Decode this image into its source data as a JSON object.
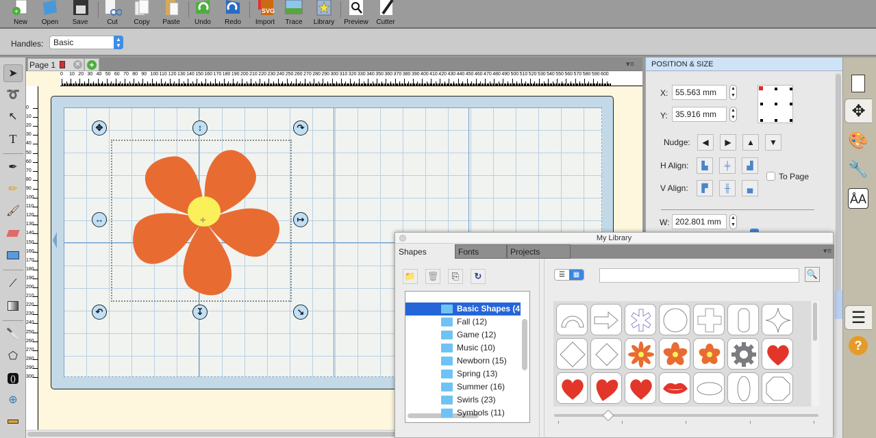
{
  "toolbar": {
    "buttons": [
      {
        "id": "new",
        "label": "New",
        "icon": "new-doc-icon"
      },
      {
        "id": "open",
        "label": "Open",
        "icon": "folder-open-icon"
      },
      {
        "id": "save",
        "label": "Save",
        "icon": "floppy-icon"
      },
      {
        "id": "cut",
        "label": "Cut",
        "icon": "scissors-icon"
      },
      {
        "id": "copy",
        "label": "Copy",
        "icon": "copy-icon"
      },
      {
        "id": "paste",
        "label": "Paste",
        "icon": "paste-icon"
      },
      {
        "id": "undo",
        "label": "Undo",
        "icon": "undo-icon"
      },
      {
        "id": "redo",
        "label": "Redo",
        "icon": "redo-icon"
      },
      {
        "id": "import",
        "label": "Import",
        "icon": "svg-import-icon"
      },
      {
        "id": "trace",
        "label": "Trace",
        "icon": "trace-icon"
      },
      {
        "id": "library",
        "label": "Library",
        "icon": "library-star-icon"
      },
      {
        "id": "preview",
        "label": "Preview",
        "icon": "magnifier-icon"
      },
      {
        "id": "cutter",
        "label": "Cutter",
        "icon": "blade-icon"
      }
    ]
  },
  "handles": {
    "label": "Handles:",
    "value": "Basic"
  },
  "document": {
    "page_tab": "Page 1",
    "hruler_labels": [
      "0",
      "10",
      "20",
      "30",
      "40",
      "50",
      "60",
      "70",
      "80",
      "90",
      "100",
      "110",
      "120",
      "130",
      "140",
      "150",
      "160",
      "170",
      "180",
      "190",
      "200",
      "210",
      "220",
      "230",
      "240",
      "250",
      "260",
      "270",
      "280",
      "290",
      "300",
      "310",
      "320",
      "330",
      "340",
      "350",
      "360",
      "370",
      "380",
      "390",
      "400",
      "410",
      "420",
      "430",
      "440",
      "450",
      "460",
      "470",
      "480",
      "490",
      "500",
      "510",
      "520",
      "530",
      "540",
      "550",
      "560",
      "570",
      "580",
      "590",
      "600"
    ],
    "vruler_labels": [
      "0",
      "10",
      "20",
      "30",
      "40",
      "50",
      "60",
      "70",
      "80",
      "90",
      "100",
      "110",
      "120",
      "130",
      "140",
      "150",
      "160",
      "170",
      "180",
      "190",
      "200",
      "210",
      "220",
      "230",
      "240",
      "250",
      "260",
      "270",
      "280",
      "290",
      "300"
    ]
  },
  "position_size": {
    "header": "POSITION & SIZE",
    "x_label": "X:",
    "x_value": "55.563 mm",
    "y_label": "Y:",
    "y_value": "35.916 mm",
    "nudge_label": "Nudge:",
    "h_align_label": "H Align:",
    "v_align_label": "V Align:",
    "to_page_label": "To Page",
    "to_page_checked": false,
    "w_label": "W:",
    "w_value": "202.801 mm",
    "keep_proportions_checked": true
  },
  "library": {
    "title": "My Library",
    "tabs": [
      "Shapes",
      "Fonts",
      "Projects"
    ],
    "active_tab": "Shapes",
    "search_placeholder": "",
    "folders": [
      {
        "name": "Basic Shapes (4",
        "selected": true
      },
      {
        "name": "Fall (12)"
      },
      {
        "name": "Game (12)"
      },
      {
        "name": "Music (10)"
      },
      {
        "name": "Newborn (15)"
      },
      {
        "name": "Spring (13)"
      },
      {
        "name": "Summer (16)"
      },
      {
        "name": "Swirls (23)"
      },
      {
        "name": "Symbols (11)"
      }
    ],
    "shapes": [
      "arch",
      "arrow",
      "asterisk",
      "circle",
      "cross",
      "rounded-rect",
      "four-point-star",
      "diamond",
      "diamond-small",
      "flower-8",
      "flower-5a",
      "flower-5b",
      "gear",
      "heart",
      "heart-2",
      "heart-tilt",
      "heart-3",
      "lips",
      "ellipse-h",
      "ellipse-v",
      "octagon"
    ]
  },
  "colors": {
    "flower": "#e86c32",
    "flower_center": "#fbf05a",
    "heart": "#e2362a",
    "accent": "#2466d8"
  }
}
